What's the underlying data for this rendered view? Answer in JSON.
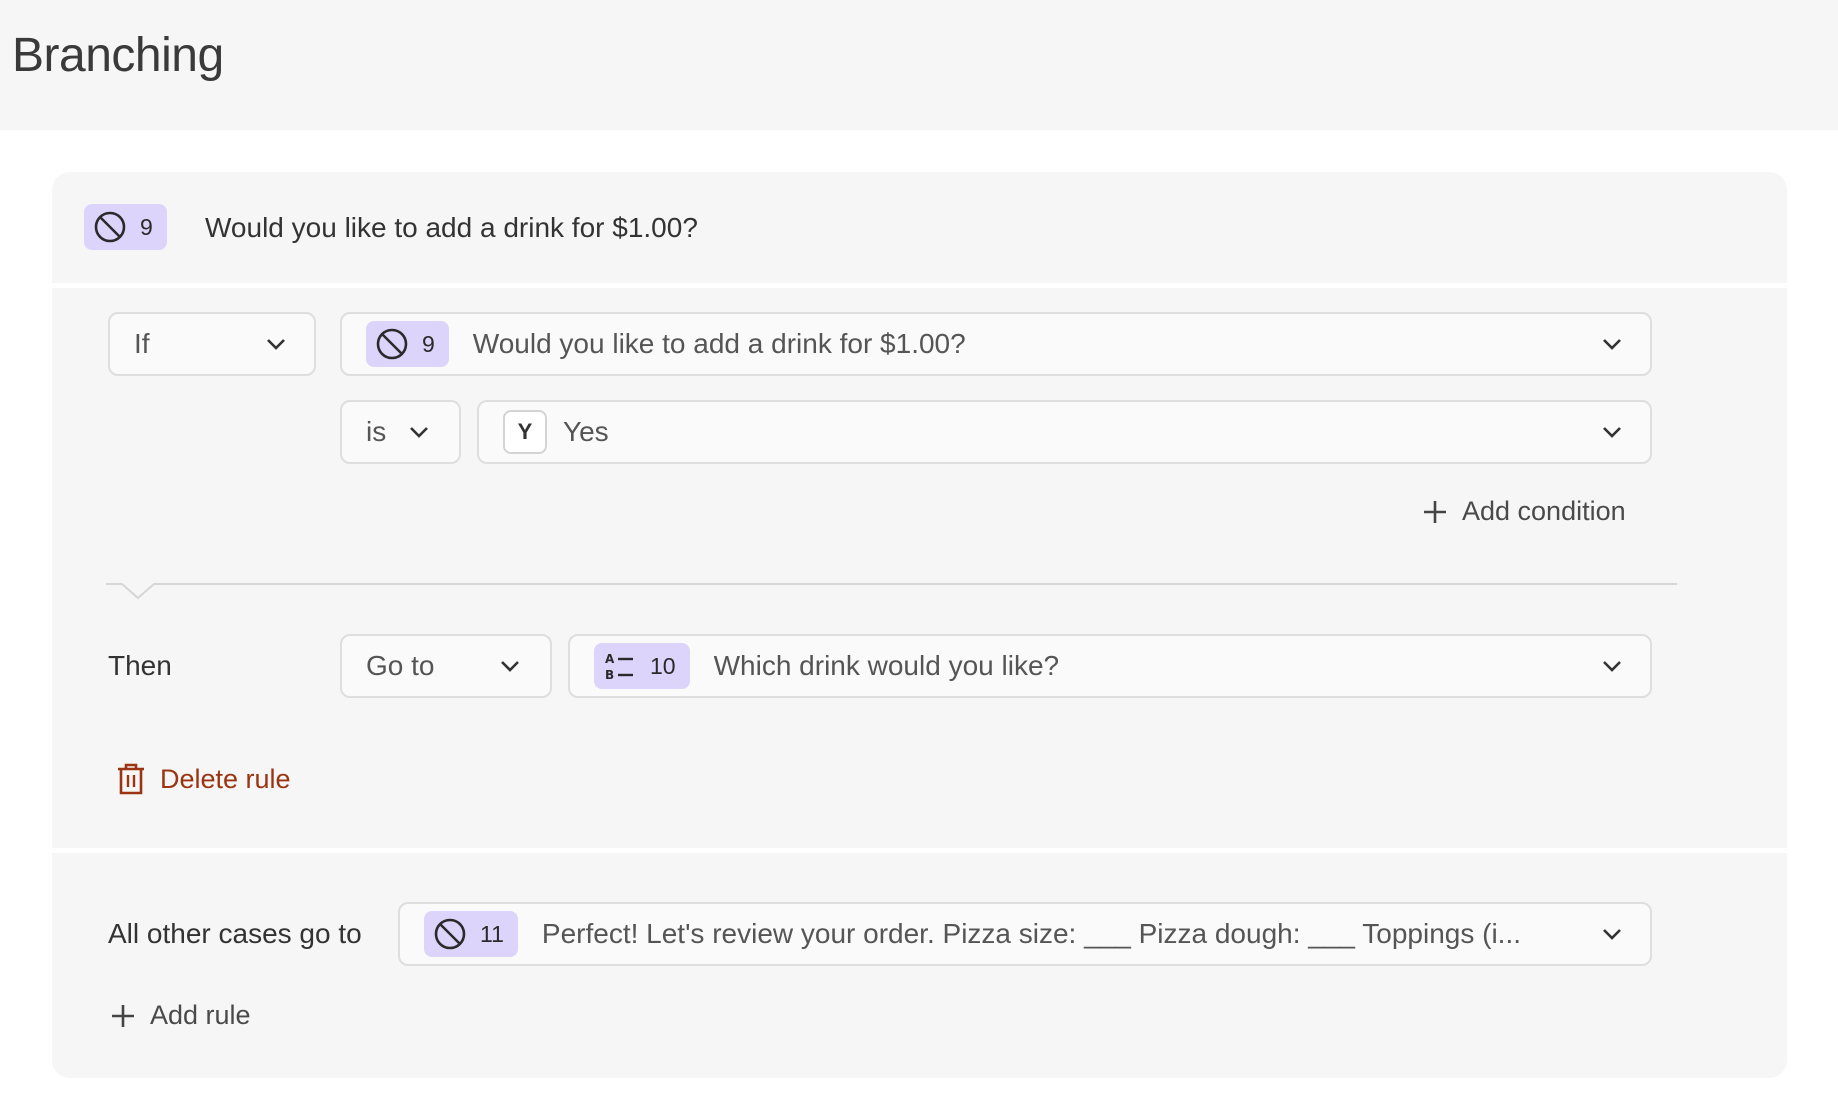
{
  "page": {
    "title": "Branching"
  },
  "question": {
    "number": "9",
    "text": "Would you like to add a drink for $1.00?",
    "icon": "slash-circle-icon"
  },
  "rule": {
    "if_label": "If",
    "condition_question": {
      "number": "9",
      "text": "Would you like to add a drink for $1.00?",
      "icon": "slash-circle-icon"
    },
    "operator": "is",
    "value_key": "Y",
    "value_label": "Yes",
    "add_condition_label": "Add condition",
    "then_label": "Then",
    "action": "Go to",
    "target_question": {
      "number": "10",
      "text": "Which drink would you like?",
      "icon": "multiple-choice-icon"
    },
    "delete_label": "Delete rule"
  },
  "fallback": {
    "label": "All other cases go to",
    "target_question": {
      "number": "11",
      "text": "Perfect! Let's review your order. Pizza size: ___ Pizza dough: ___ Toppings (i...",
      "icon": "slash-circle-icon"
    },
    "add_rule_label": "Add rule"
  },
  "colors": {
    "badge": "#dcd4fb",
    "delete": "#9a3412",
    "card": "#f6f6f6"
  }
}
